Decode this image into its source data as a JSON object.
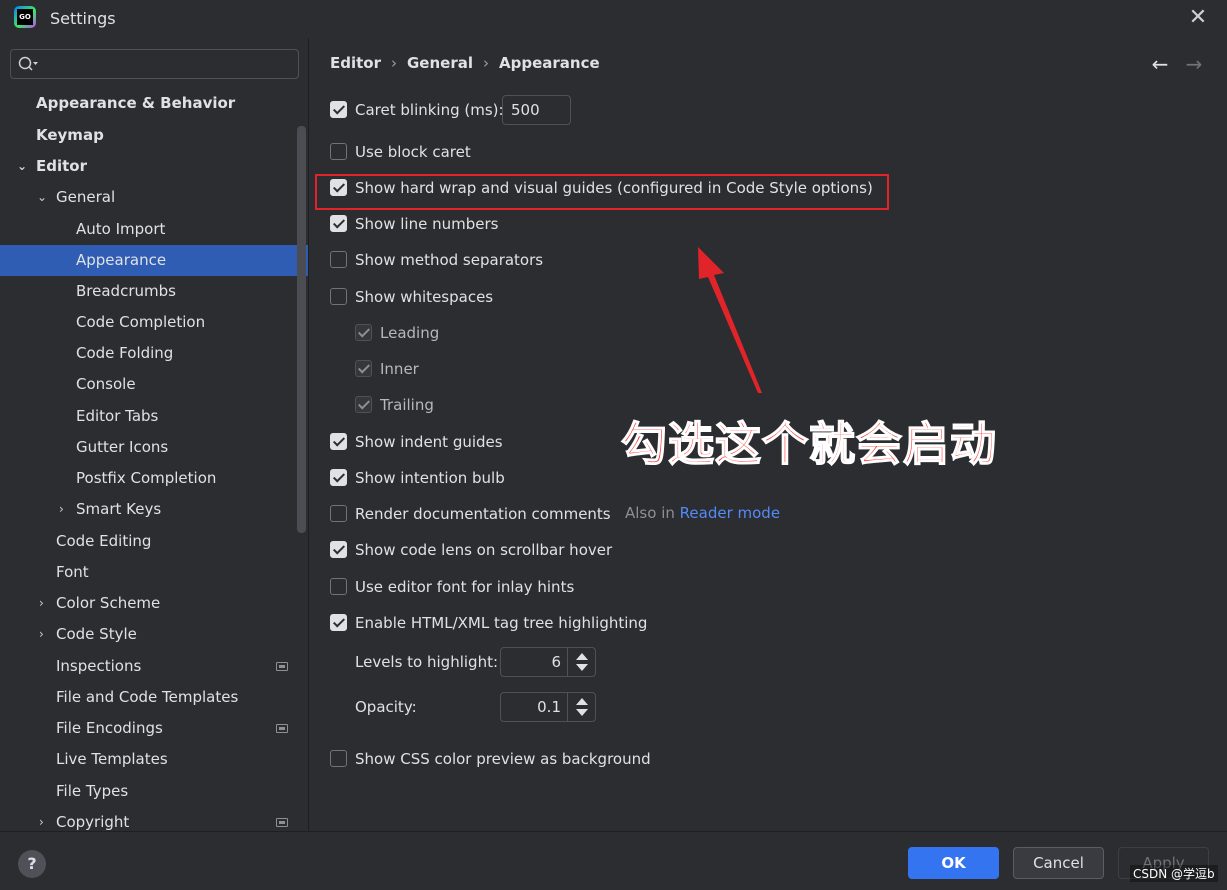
{
  "window": {
    "title": "Settings",
    "logo_text": "GO"
  },
  "search": {
    "placeholder": "",
    "value": ""
  },
  "sidebar": {
    "items": [
      {
        "label": "Appearance & Behavior",
        "bold": true
      },
      {
        "label": "Keymap",
        "bold": true
      },
      {
        "label": "Editor",
        "bold": true,
        "expanded": true
      },
      {
        "label": "General",
        "expanded": true
      },
      {
        "label": "Auto Import"
      },
      {
        "label": "Appearance",
        "selected": true
      },
      {
        "label": "Breadcrumbs"
      },
      {
        "label": "Code Completion"
      },
      {
        "label": "Code Folding"
      },
      {
        "label": "Console"
      },
      {
        "label": "Editor Tabs"
      },
      {
        "label": "Gutter Icons"
      },
      {
        "label": "Postfix Completion"
      },
      {
        "label": "Smart Keys",
        "collapsed": true
      },
      {
        "label": "Code Editing"
      },
      {
        "label": "Font"
      },
      {
        "label": "Color Scheme",
        "collapsed": true
      },
      {
        "label": "Code Style",
        "collapsed": true
      },
      {
        "label": "Inspections",
        "project_icon": true
      },
      {
        "label": "File and Code Templates"
      },
      {
        "label": "File Encodings",
        "project_icon": true
      },
      {
        "label": "Live Templates"
      },
      {
        "label": "File Types"
      },
      {
        "label": "Copyright",
        "collapsed": true,
        "project_icon": true
      }
    ]
  },
  "breadcrumb": [
    "Editor",
    "General",
    "Appearance"
  ],
  "breadcrumb_sep": "›",
  "options": {
    "caret_blinking": {
      "label": "Caret blinking (ms):",
      "checked": true,
      "value": "500"
    },
    "block_caret": {
      "label": "Use block caret",
      "checked": false
    },
    "hard_wrap": {
      "label": "Show hard wrap and visual guides (configured in Code Style options)",
      "checked": true
    },
    "line_numbers": {
      "label": "Show line numbers",
      "checked": true
    },
    "method_separators": {
      "label": "Show method separators",
      "checked": false
    },
    "whitespaces": {
      "label": "Show whitespaces",
      "checked": false
    },
    "leading": {
      "label": "Leading",
      "checked": true
    },
    "inner": {
      "label": "Inner",
      "checked": true
    },
    "trailing": {
      "label": "Trailing",
      "checked": true
    },
    "indent_guides": {
      "label": "Show indent guides",
      "checked": true
    },
    "intention_bulb": {
      "label": "Show intention bulb",
      "checked": true
    },
    "render_docs": {
      "label": "Render documentation comments",
      "checked": false,
      "also_in": "Also in",
      "link": "Reader mode"
    },
    "code_lens": {
      "label": "Show code lens on scrollbar hover",
      "checked": true
    },
    "editor_font_inlay": {
      "label": "Use editor font for inlay hints",
      "checked": false
    },
    "tag_tree": {
      "label": "Enable HTML/XML tag tree highlighting",
      "checked": true
    },
    "levels": {
      "label": "Levels to highlight:",
      "value": "6"
    },
    "opacity": {
      "label": "Opacity:",
      "value": "0.1"
    },
    "css_color": {
      "label": "Show CSS color preview as background",
      "checked": false
    }
  },
  "annotation": {
    "text": "勾选这个就会启动",
    "color": "#ff2a2a"
  },
  "footer": {
    "help": "?",
    "ok": "OK",
    "cancel": "Cancel",
    "apply": "Apply"
  },
  "watermark": "CSDN @学逗b",
  "colors": {
    "accent": "#3574f0",
    "selection": "#2f5db3",
    "link": "#548af7",
    "highlight_border": "#e0242a"
  }
}
